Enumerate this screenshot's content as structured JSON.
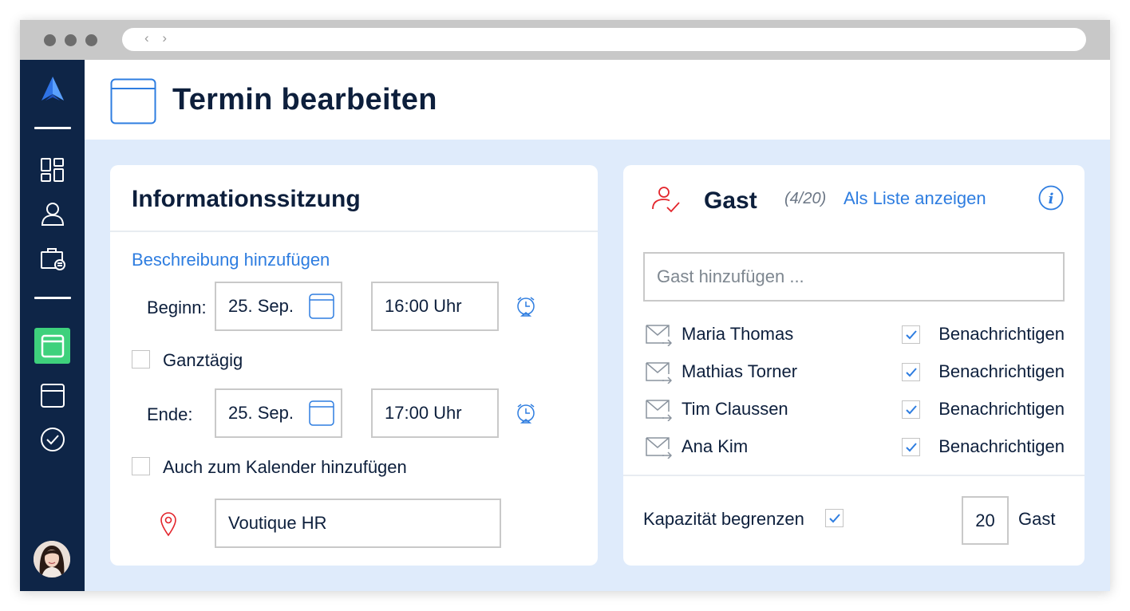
{
  "browser": {
    "nav_arrows": "‹ ›"
  },
  "header": {
    "title": "Termin bearbeiten"
  },
  "event": {
    "title": "Informationssitzung",
    "add_description_link": "Beschreibung hinzufügen",
    "start": {
      "label": "Beginn:",
      "date": "25. Sep.",
      "time": "16:00 Uhr"
    },
    "all_day": {
      "label": "Ganztägig",
      "checked": false
    },
    "end": {
      "label": "Ende:",
      "date": "25. Sep.",
      "time": "17:00 Uhr"
    },
    "add_to_calendar": {
      "label": "Auch zum Kalender hinzufügen",
      "checked": false
    },
    "location": "Voutique HR"
  },
  "guests": {
    "title": "Gast",
    "count": "(4/20)",
    "list_link": "Als Liste anzeigen",
    "input_placeholder": "Gast hinzufügen ...",
    "notify_label": "Benachrichtigen",
    "items": [
      {
        "name": "Maria Thomas",
        "notify": true
      },
      {
        "name": "Mathias Torner",
        "notify": true
      },
      {
        "name": "Tim Claussen",
        "notify": true
      },
      {
        "name": "Ana Kim",
        "notify": true
      }
    ],
    "capacity": {
      "label": "Kapazität begrenzen",
      "checked": true,
      "value": "20",
      "unit": "Gast"
    }
  },
  "colors": {
    "sidebar": "#0e2547",
    "accent_blue": "#2e7de0",
    "active_green": "#3ed17c",
    "danger_red": "#e3242b",
    "background": "#dfebfb"
  },
  "icons": [
    "logo-icon",
    "dashboard-icon",
    "user-icon",
    "briefcase-icon",
    "calendar-icon",
    "calendar-outline-icon",
    "check-circle-icon",
    "calendar-picker-icon",
    "alarm-clock-icon",
    "location-pin-icon",
    "user-check-icon",
    "info-icon",
    "mail-forward-icon",
    "checkmark-icon"
  ]
}
